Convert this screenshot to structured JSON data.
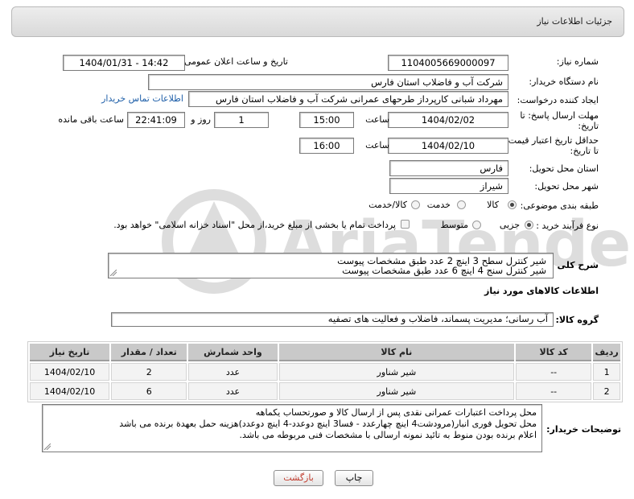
{
  "panel": {
    "title": "جزئیات اطلاعات نیاز"
  },
  "need_number": {
    "label": "شماره نیاز:",
    "value": "1104005669000097"
  },
  "announce": {
    "label": "تاریخ و ساعت اعلان عمومی:",
    "value": "1404/01/31 - 14:42"
  },
  "buyer_org": {
    "label": "نام دستگاه خریدار:",
    "value": "شرکت آب و فاضلاب استان فارس"
  },
  "requester": {
    "label": "ایجاد کننده درخواست:",
    "value": "مهرداد شبانی کارپرداز طرحهای عمرانی  شرکت آب و فاضلاب استان فارس",
    "contact_link": "اطلاعات تماس خریدار"
  },
  "reply_deadline": {
    "label_line1": "مهلت ارسال پاسخ: تا",
    "label_line2": "تاریخ:",
    "date": "1404/02/02",
    "time_label": "ساعت",
    "time": "15:00",
    "days": "1",
    "days_label": "روز و",
    "remaining": "22:41:09",
    "remaining_label": "ساعت باقی مانده"
  },
  "price_validity": {
    "label_line1": "حداقل تاریخ اعتبار قیمت:",
    "label_line2": "تا تاریخ:",
    "date": "1404/02/10",
    "time_label": "ساعت",
    "time": "16:00"
  },
  "delivery_province": {
    "label": "استان محل تحویل:",
    "value": "فارس"
  },
  "delivery_city": {
    "label": "شهر محل تحویل:",
    "value": "شیراز"
  },
  "category": {
    "label": "طبقه بندی موضوعی:",
    "options": [
      "کالا",
      "خدمت",
      "کالا/خدمت"
    ],
    "selected": "کالا"
  },
  "purchase_type": {
    "label": "نوع فرآیند خرید :",
    "options": [
      "جزیی",
      "متوسط"
    ],
    "selected": "جزیی",
    "treasury_note": "پرداخت تمام یا بخشی از مبلغ خرید،از محل \"اسناد خزانه اسلامی\" خواهد بود."
  },
  "overall_desc": {
    "label": "شرح کلی نیاز:",
    "line1": "شیر کنترل سطح 3 اینچ 2 عدد طبق مشخصات پیوست",
    "line2": "شیر کنترل سنج 4 اینچ 6 عدد طبق مشخصات پیوست"
  },
  "goods_info": {
    "title": "اطلاعات کالاهای مورد نیاز"
  },
  "goods_group": {
    "label": "گروه کالا:",
    "value": "آب رسانی؛ مدیریت پسماند، فاضلاب و فعالیت های تصفیه"
  },
  "goods_table": {
    "headers": [
      "ردیف",
      "کد کالا",
      "نام کالا",
      "واحد شمارش",
      "تعداد / مقدار",
      "تاریخ نیاز"
    ],
    "rows": [
      [
        "1",
        "--",
        "شیر شناور",
        "عدد",
        "2",
        "1404/02/10"
      ],
      [
        "2",
        "--",
        "شیر شناور",
        "عدد",
        "6",
        "1404/02/10"
      ]
    ]
  },
  "buyer_notes": {
    "label": "توضیحات خریدار:",
    "line1": "محل پرداخت اعتبارات عمرانی نقدی پس از ارسال کالا و صورتحساب یکماهه",
    "line2": "محل تحویل فوری انبار(مرودشت4 اینچ چهارعدد - فسا3 اینچ دوعدد-4 اینچ دوعدد)هزینه حمل بعهدة برنده می باشد",
    "line3": "اعلام برنده بودن منوط به تائید نمونه ارسالی با مشخصات فنی مربوطه می باشد."
  },
  "buttons": {
    "print": "چاپ",
    "back": "بازگشت"
  },
  "watermark": {
    "text": "AriaTender.neT"
  },
  "colors": {
    "link": "#1d5ea8",
    "back_button_text": "#c0392b",
    "header_bg": "#d9d9d9"
  }
}
